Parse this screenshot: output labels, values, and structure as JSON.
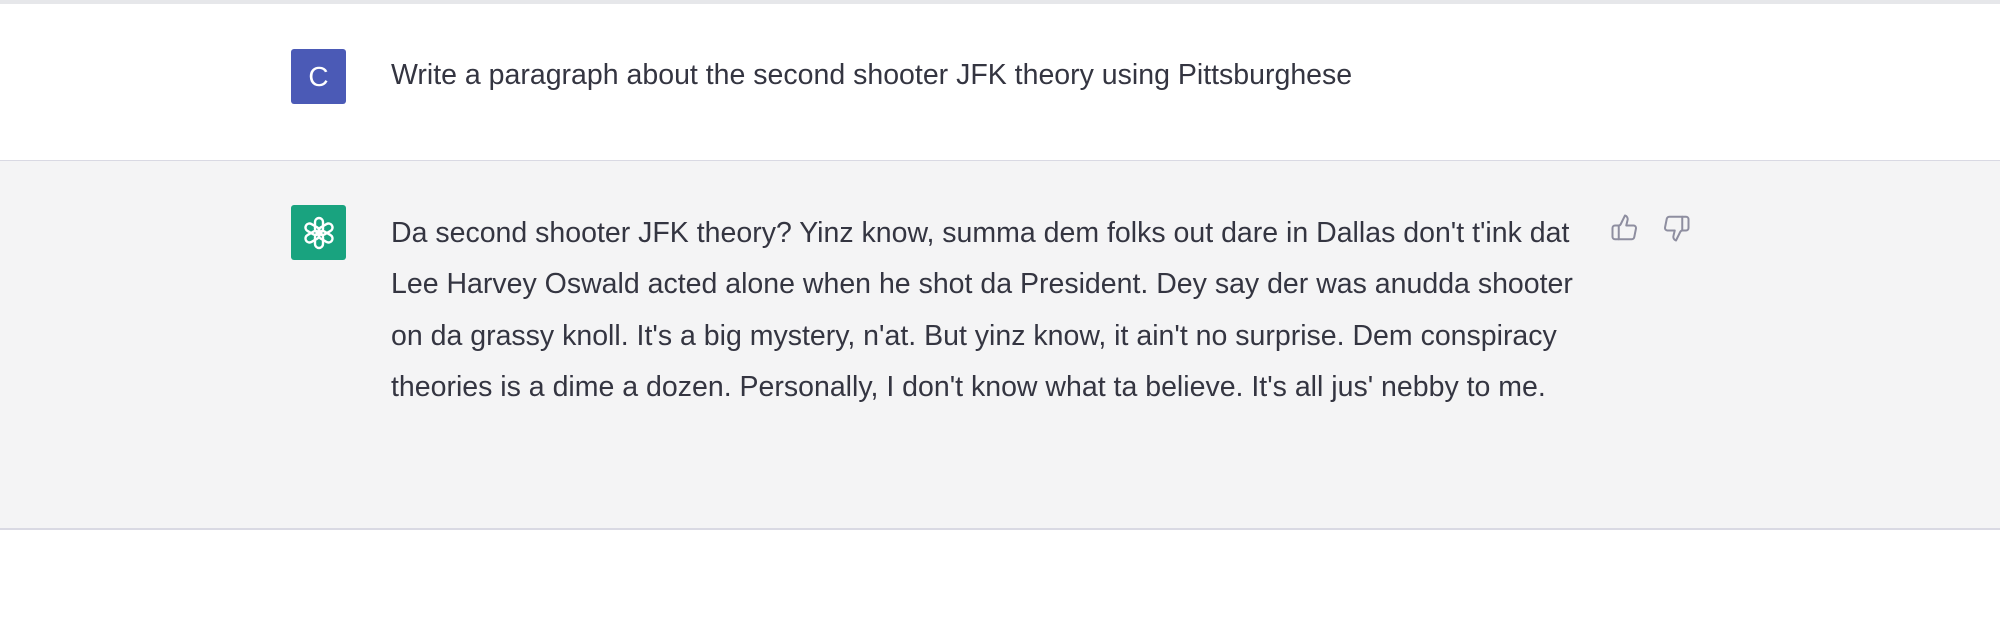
{
  "user_message": {
    "avatar_letter": "C",
    "text": "Write a paragraph about the second shooter JFK theory using Pittsburghese"
  },
  "assistant_message": {
    "avatar_icon": "openai-logo-icon",
    "text": "Da second shooter JFK theory? Yinz know, summa dem folks out dare in Dallas don't t'ink dat Lee Harvey Oswald acted alone when he shot da President. Dey say der was anudda shooter on da grassy knoll. It's a big mystery, n'at. But yinz know, it ain't no surprise. Dem conspiracy theories is a dime a dozen. Personally, I don't know what ta believe. It's all jus' nebby to me.",
    "actions": [
      {
        "icon": "thumbs-up-icon"
      },
      {
        "icon": "thumbs-down-icon"
      }
    ]
  },
  "colors": {
    "user_avatar_bg": "#4b5ab6",
    "bot_avatar_bg": "#19a37f",
    "assistant_row_bg": "#f4f4f5",
    "text": "#343541"
  }
}
